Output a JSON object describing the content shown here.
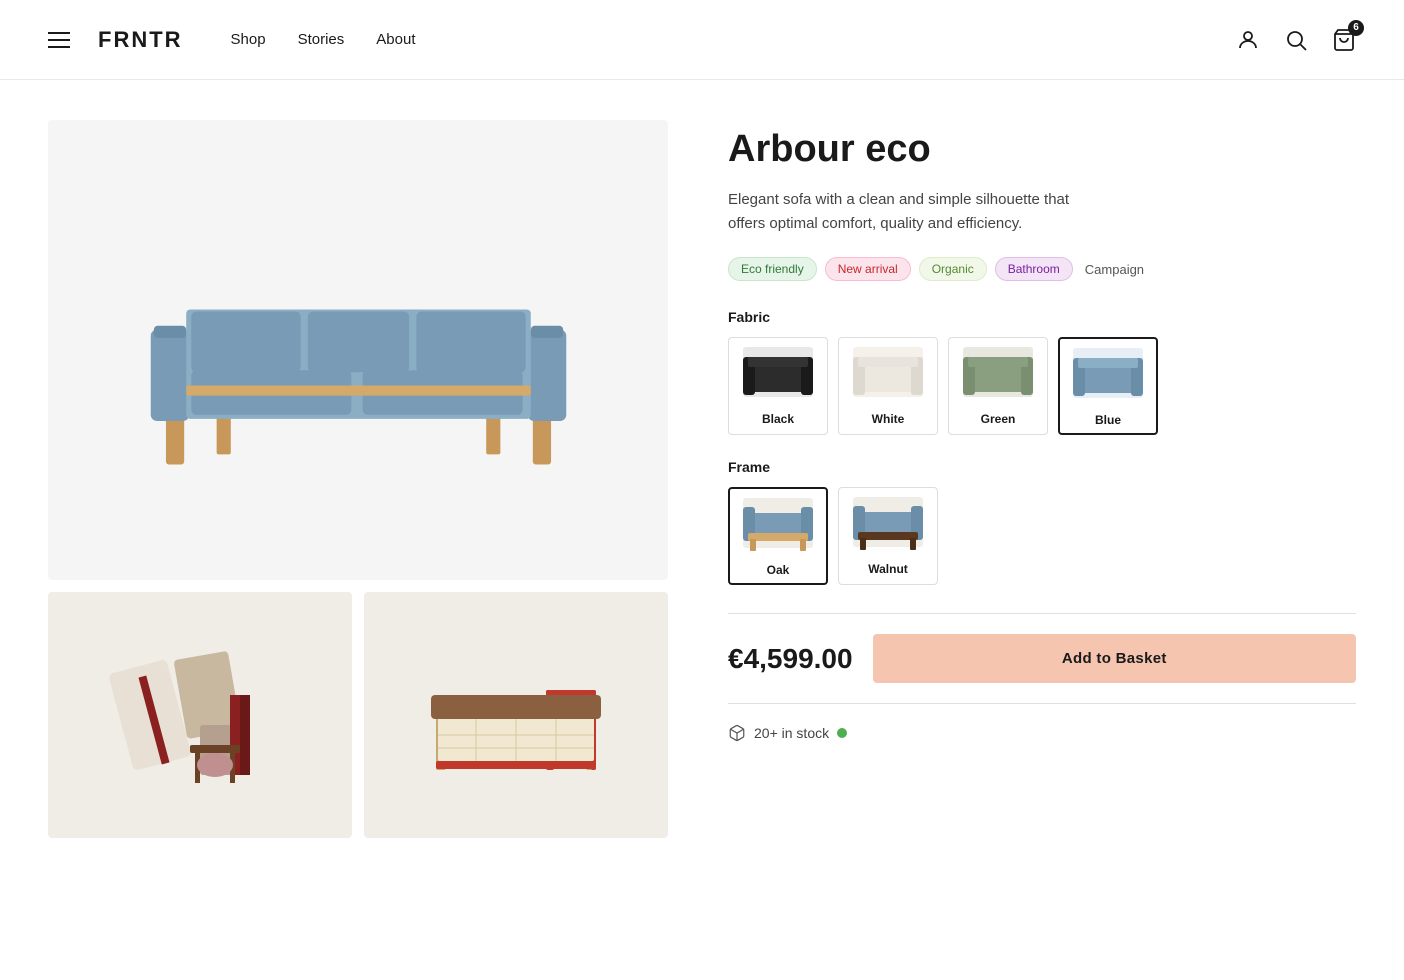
{
  "header": {
    "logo": "FRNTR",
    "nav": [
      {
        "label": "Shop",
        "href": "#"
      },
      {
        "label": "Stories",
        "href": "#"
      },
      {
        "label": "About",
        "href": "#"
      }
    ],
    "cart_count": "6"
  },
  "product": {
    "title": "Arbour eco",
    "description": "Elegant sofa with a clean and simple silhouette that offers optimal comfort, quality and efficiency.",
    "tags": [
      {
        "label": "Eco friendly",
        "style": "green"
      },
      {
        "label": "New arrival",
        "style": "pink"
      },
      {
        "label": "Organic",
        "style": "lime"
      },
      {
        "label": "Bathroom",
        "style": "mauve"
      },
      {
        "label": "Campaign",
        "style": "plain"
      }
    ],
    "fabric_label": "Fabric",
    "fabrics": [
      {
        "name": "Black",
        "selected": false
      },
      {
        "name": "White",
        "selected": false
      },
      {
        "name": "Green",
        "selected": false
      },
      {
        "name": "Blue",
        "selected": true
      }
    ],
    "frame_label": "Frame",
    "frames": [
      {
        "name": "Oak",
        "selected": true
      },
      {
        "name": "Walnut",
        "selected": false
      }
    ],
    "price": "€4,599.00",
    "add_to_basket_label": "Add to Basket",
    "stock_label": "20+ in stock"
  }
}
